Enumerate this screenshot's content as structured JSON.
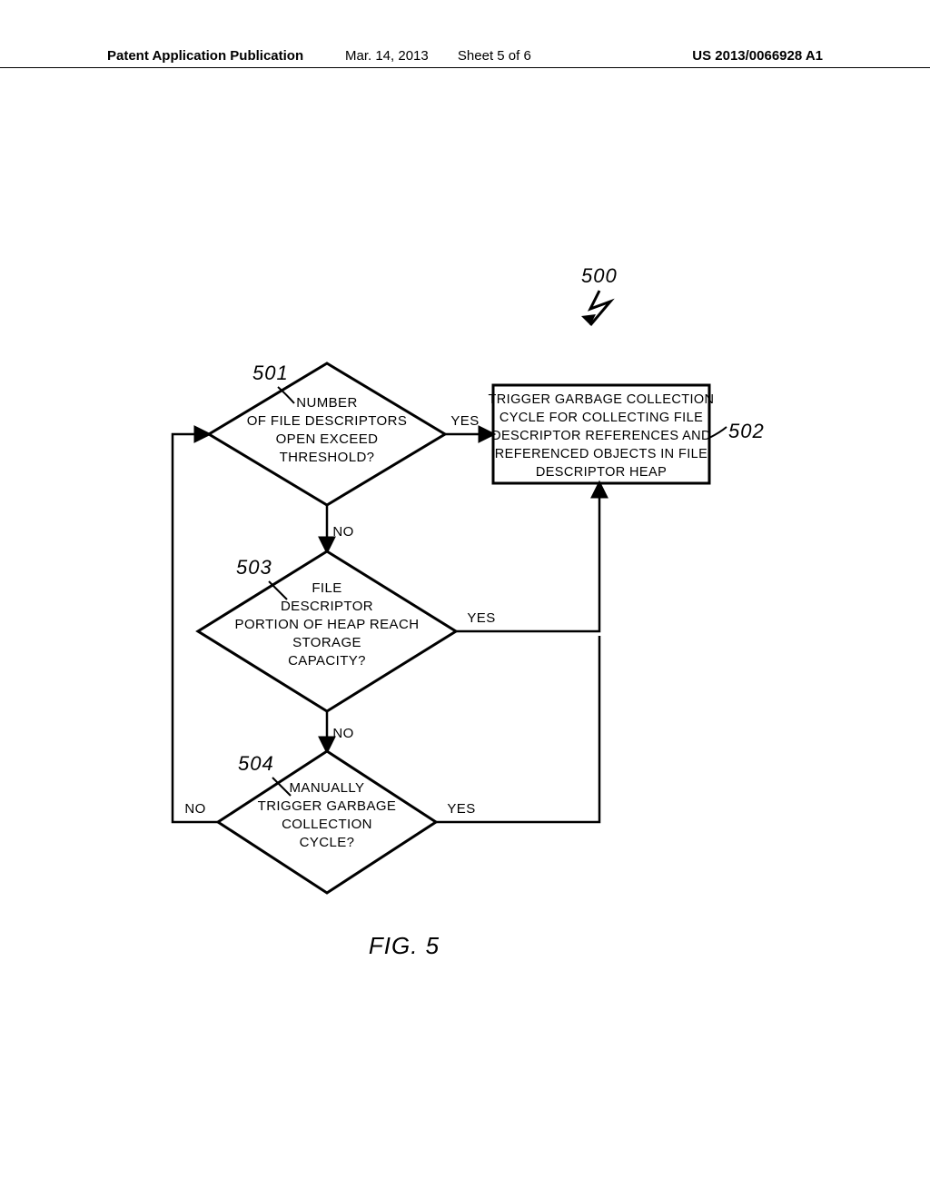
{
  "header": {
    "left": "Patent Application Publication",
    "date": "Mar. 14, 2013",
    "sheet": "Sheet 5 of 6",
    "pubno": "US 2013/0066928 A1"
  },
  "figure_label": "FIG. 5",
  "ref_500": "500",
  "ref_501": "501",
  "ref_502": "502",
  "ref_503": "503",
  "ref_504": "504",
  "d501": {
    "l1": "NUMBER",
    "l2": "OF FILE DESCRIPTORS",
    "l3": "OPEN EXCEED",
    "l4": "THRESHOLD?"
  },
  "d503": {
    "l1": "FILE",
    "l2": "DESCRIPTOR",
    "l3": "PORTION OF HEAP REACH",
    "l4": "STORAGE",
    "l5": "CAPACITY?"
  },
  "d504": {
    "l1": "MANUALLY",
    "l2": "TRIGGER GARBAGE",
    "l3": "COLLECTION",
    "l4": "CYCLE?"
  },
  "box502": {
    "l1": "TRIGGER GARBAGE COLLECTION",
    "l2": "CYCLE FOR COLLECTING FILE",
    "l3": "DESCRIPTOR REFERENCES AND",
    "l4": "REFERENCED OBJECTS IN FILE",
    "l5": "DESCRIPTOR HEAP"
  },
  "labels": {
    "yes": "YES",
    "no": "NO"
  },
  "chart_data": {
    "type": "flowchart",
    "title": "FIG. 5",
    "figure_ref": "500",
    "nodes": [
      {
        "id": "501",
        "ref": "501",
        "shape": "decision",
        "text": "NUMBER OF FILE DESCRIPTORS OPEN EXCEED THRESHOLD?"
      },
      {
        "id": "502",
        "ref": "502",
        "shape": "process",
        "text": "TRIGGER GARBAGE COLLECTION CYCLE FOR COLLECTING FILE DESCRIPTOR REFERENCES AND REFERENCED OBJECTS IN FILE DESCRIPTOR HEAP"
      },
      {
        "id": "503",
        "ref": "503",
        "shape": "decision",
        "text": "FILE DESCRIPTOR PORTION OF HEAP REACH STORAGE CAPACITY?"
      },
      {
        "id": "504",
        "ref": "504",
        "shape": "decision",
        "text": "MANUALLY TRIGGER GARBAGE COLLECTION CYCLE?"
      }
    ],
    "edges": [
      {
        "from": "501",
        "to": "502",
        "label": "YES"
      },
      {
        "from": "501",
        "to": "503",
        "label": "NO"
      },
      {
        "from": "503",
        "to": "502",
        "label": "YES"
      },
      {
        "from": "503",
        "to": "504",
        "label": "NO"
      },
      {
        "from": "504",
        "to": "502",
        "label": "YES"
      },
      {
        "from": "504",
        "to": "501",
        "label": "NO",
        "note": "loop back"
      }
    ]
  }
}
